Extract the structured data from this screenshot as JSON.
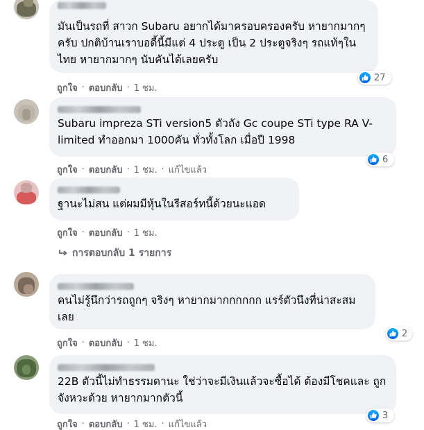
{
  "colors": {
    "bubble_bg": "#f0f2f5",
    "action_text": "#65676b",
    "like_blue": "#1877f2",
    "text": "#050505"
  },
  "comments": [
    {
      "author": "",
      "text": "มันเป็นรถที่ สาวก Subaru อยากได้มาครอบครองครับ หายากมากๆครับ ปกติบ้านเราบอดี้นี้มีแต่ 4 ประตู เป็น 2 ประตูจริงๆ รถแท้ๆในไทย หายากมากๆ นับคันได้เลยครับ",
      "reaction_icon": "like-icon",
      "reaction_count": "27",
      "like_label": "ถูกใจ",
      "reply_label": "ตอบกลับ",
      "time": "1 ชม.",
      "edited": ""
    },
    {
      "author": "",
      "text": "Subaru impreza STi version5 ตัวถัง Gc coupe STi type RA V-limited ทำออกมา 1000คัน ทั่วทั้งโลก เมื่อปี 1998",
      "reaction_icon": "like-icon",
      "reaction_count": "6",
      "like_label": "ถูกใจ",
      "reply_label": "ตอบกลับ",
      "time": "1 ชม.",
      "edited": "แก้ไขแล้ว"
    },
    {
      "author": "",
      "text": "ฐานะไม่สน แต่ผมมีหุ้นในรีสอร์ทนี้ด้วยนะแอด",
      "reaction_icon": "",
      "reaction_count": "",
      "like_label": "ถูกใจ",
      "reply_label": "ตอบกลับ",
      "time": "1 ชม.",
      "edited": "",
      "replies_label": "การตอบกลับ 1 รายการ"
    },
    {
      "author": "",
      "text": "คนไม่รู้นึกว่ารถถูกๆ จริงๆ หายากมากกกกกก แรร์ตัวนึงที่น่าสะสมเลย",
      "reaction_icon": "like-icon",
      "reaction_count": "2",
      "like_label": "ถูกใจ",
      "reply_label": "ตอบกลับ",
      "time": "1 ชม.",
      "edited": ""
    },
    {
      "author": "",
      "text": "22B ตัวนี้ไม่ทำธรรมดานะ ใช่ว่าจะมีเงินแล้วจะซื้อได้ ต้องมีโชคและ ถูกจังหวะด้วย หายากมากตัวนี้",
      "reaction_icon": "like-icon",
      "reaction_count": "3",
      "like_label": "ถูกใจ",
      "reply_label": "ตอบกลับ",
      "time": "1 ชม.",
      "edited": "แก้ไขแล้ว"
    }
  ]
}
